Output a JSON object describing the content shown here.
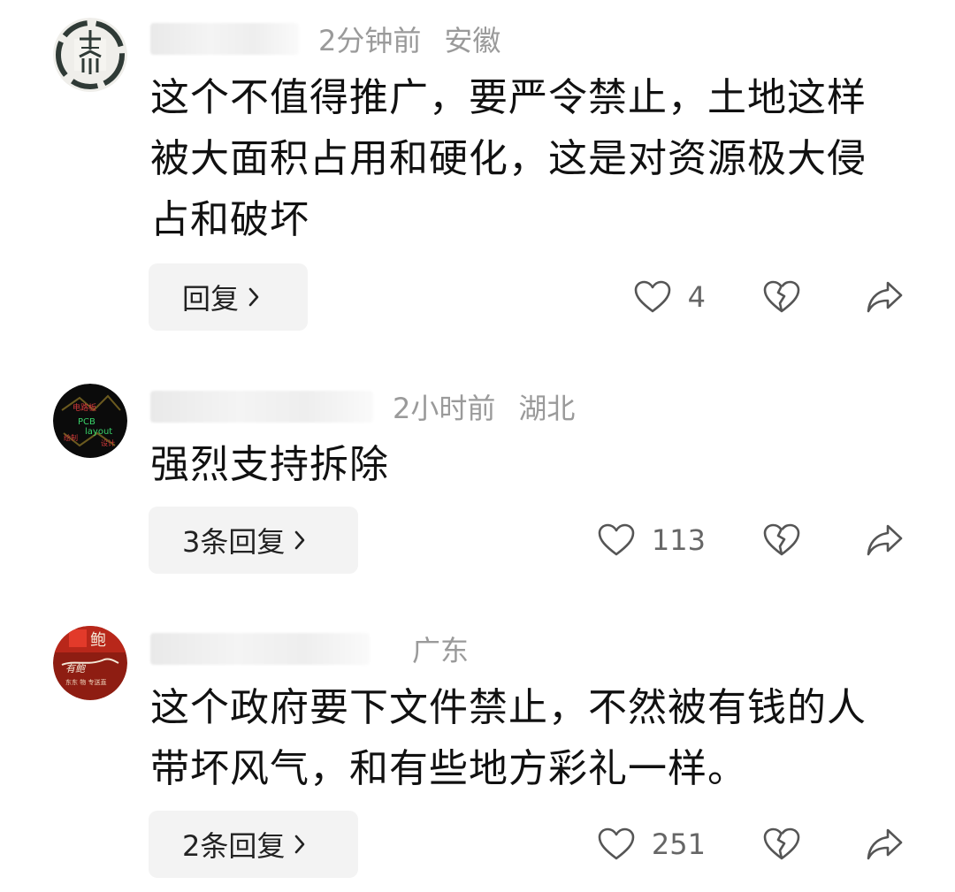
{
  "comments": [
    {
      "time": "2分钟前",
      "location": "安徽",
      "text": "这个不值得推广，要严令禁止，土地这样被大面积占用和硬化，这是对资源极大侵占和破坏",
      "reply_label": "回复",
      "likes": "4",
      "avatar_icon": "ink-seal-avatar"
    },
    {
      "time": "2小时前",
      "location": "湖北",
      "text": "强烈支持拆除",
      "reply_label": "3条回复",
      "likes": "113",
      "avatar_icon": "neon-pcb-avatar"
    },
    {
      "time": "",
      "location": "广东",
      "text": "这个政府要下文件禁止，不然被有钱的人带坏风气，和有些地方彩礼一样。",
      "reply_label": "2条回复",
      "likes": "251",
      "avatar_icon": "red-calligraphy-avatar"
    }
  ],
  "icons": {
    "like": "heart-outline-icon",
    "dislike": "broken-heart-icon",
    "share": "share-arrow-icon",
    "chevron": "chevron-right-icon"
  },
  "colors": {
    "meta_gray": "#9a9a9a",
    "reply_bg": "#f3f3f3",
    "text": "#111111"
  }
}
